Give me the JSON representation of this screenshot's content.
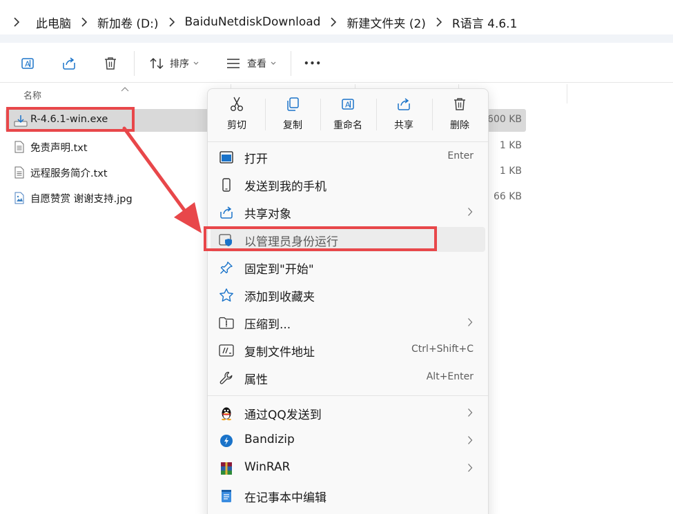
{
  "breadcrumb": {
    "items": [
      "此电脑",
      "新加卷 (D:)",
      "BaiduNetdiskDownload",
      "新建文件夹 (2)",
      "R语言 4.6.1"
    ]
  },
  "toolbar": {
    "sort_label": "排序",
    "view_label": "查看",
    "more_label": "•••"
  },
  "list": {
    "header_name": "名称",
    "files": [
      {
        "name": "R-4.6.1-win.exe",
        "size": "600 KB",
        "icon": "installer-icon"
      },
      {
        "name": "免责声明.txt",
        "size": "1 KB",
        "icon": "text-file-icon"
      },
      {
        "name": "远程服务简介.txt",
        "size": "1 KB",
        "icon": "text-file-icon"
      },
      {
        "name": "自愿赞赏 谢谢支持.jpg",
        "size": "66 KB",
        "icon": "image-file-icon"
      }
    ]
  },
  "context_menu": {
    "quick_actions": [
      "剪切",
      "复制",
      "重命名",
      "共享",
      "删除"
    ],
    "items": [
      {
        "label": "打开",
        "shortcut": "Enter"
      },
      {
        "label": "发送到我的手机",
        "shortcut": ""
      },
      {
        "label": "共享对象",
        "shortcut": ""
      },
      {
        "label": "以管理员身份运行",
        "shortcut": ""
      },
      {
        "label": "固定到\"开始\"",
        "shortcut": ""
      },
      {
        "label": "添加到收藏夹",
        "shortcut": ""
      },
      {
        "label": "压缩到...",
        "shortcut": ""
      },
      {
        "label": "复制文件地址",
        "shortcut": "Ctrl+Shift+C"
      },
      {
        "label": "属性",
        "shortcut": "Alt+Enter"
      },
      {
        "label": "通过QQ发送到",
        "shortcut": ""
      },
      {
        "label": "Bandizip",
        "shortcut": ""
      },
      {
        "label": "WinRAR",
        "shortcut": ""
      },
      {
        "label": "在记事本中编辑",
        "shortcut": ""
      }
    ]
  },
  "colors": {
    "annotation_red": "#e8474a",
    "accent_blue": "#1a73c9"
  }
}
